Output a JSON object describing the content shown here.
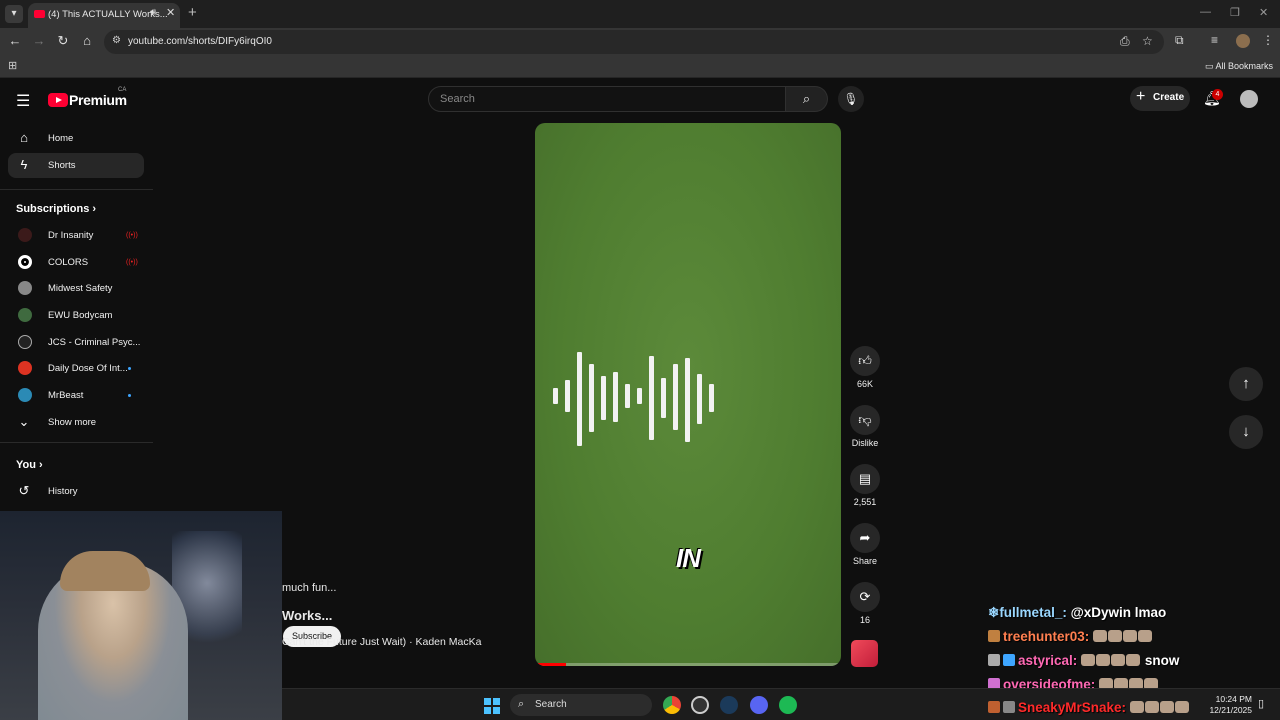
{
  "browser": {
    "tab_title": "(4) This ACTUALLY Works...",
    "url": "youtube.com/shorts/DIFy6irqOI0",
    "all_bookmarks": "All Bookmarks"
  },
  "youtube": {
    "logo_text": "Premium",
    "logo_region": "CA",
    "search_placeholder": "Search",
    "create_label": "Create",
    "notif_count": "4"
  },
  "sidebar": {
    "home": "Home",
    "shorts": "Shorts",
    "subscriptions_heading": "Subscriptions",
    "subscriptions": [
      {
        "name": "Dr Insanity",
        "indicator": "live"
      },
      {
        "name": "COLORS",
        "indicator": "live"
      },
      {
        "name": "Midwest Safety",
        "indicator": ""
      },
      {
        "name": "EWU Bodycam",
        "indicator": ""
      },
      {
        "name": "JCS - Criminal Psyc...",
        "indicator": ""
      },
      {
        "name": "Daily Dose Of Int...",
        "indicator": "new"
      },
      {
        "name": "MrBeast",
        "indicator": "new"
      }
    ],
    "show_more": "Show more",
    "you_heading": "You",
    "history": "History"
  },
  "short": {
    "caption": "IN",
    "progress": 0.1,
    "overlay_subscribe": "Subscribe",
    "overlay_desc": "much fun...",
    "overlay_title": "Works...",
    "overlay_audio": "Can't the Future Just Wait) · Kaden MacKa"
  },
  "actions": {
    "likes": "66K",
    "dislike": "Dislike",
    "comments": "2,551",
    "share": "Share",
    "remix": "16"
  },
  "chat": [
    {
      "user": "fullmetal_:",
      "message": "@xDywin lmao",
      "color": "#9ad7ff",
      "emotes": 0
    },
    {
      "user": "treehunter03:",
      "message": "",
      "color": "#ff7f50",
      "emotes": 4
    },
    {
      "user": "astyrical:",
      "message": "snow",
      "color": "#ff69b4",
      "emotes": 4
    },
    {
      "user": "oversideofme:",
      "message": "",
      "color": "#ff69b4",
      "emotes": 4
    },
    {
      "user": "SneakyMrSnake:",
      "message": "",
      "color": "#ff2a2a",
      "emotes": 5
    }
  ],
  "taskbar": {
    "search_label": "Search",
    "time": "10:24 PM",
    "date": "12/21/2025"
  }
}
